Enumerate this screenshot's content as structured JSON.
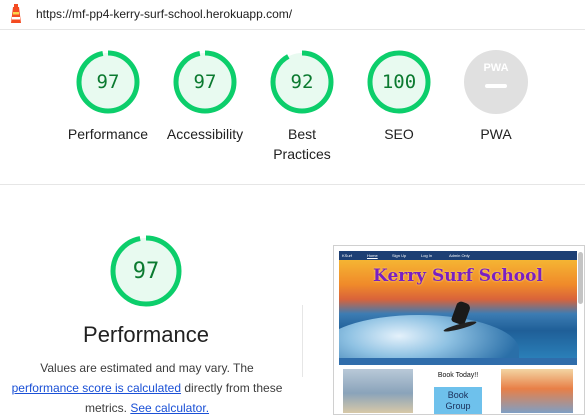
{
  "url": "https://mf-pp4-kerry-surf-school.herokuapp.com/",
  "gauges": [
    {
      "score": "97",
      "label": "Performance",
      "fraction": 0.97
    },
    {
      "score": "97",
      "label": "Accessibility",
      "fraction": 0.97
    },
    {
      "score": "92",
      "label": "Best Practices",
      "label_line1": "Best",
      "label_line2": "Practices",
      "fraction": 0.92
    },
    {
      "score": "100",
      "label": "SEO",
      "fraction": 1.0
    },
    {
      "score": "PWA",
      "label": "PWA"
    }
  ],
  "performance": {
    "score": "97",
    "fraction": 0.97,
    "title": "Performance",
    "desc_prefix": "Values are estimated and may vary. The",
    "score_link": "performance score is calculated",
    "desc_mid": "directly from these metrics.",
    "calc_link": "See calculator."
  },
  "screenshot": {
    "nav_brand": "KSurf",
    "nav_items": [
      "Home",
      "Sign Up",
      "Log In",
      "Admin Only"
    ],
    "site_title": "Kerry Surf School",
    "book_today": "Book Today!!",
    "book_button": "Book Group"
  },
  "colors": {
    "pass": "#0cce6b",
    "pass_fill": "#e8faf0",
    "pass_text": "#0b7a30",
    "pwa_gray": "#e0e0e0",
    "link": "#1a50d6"
  }
}
